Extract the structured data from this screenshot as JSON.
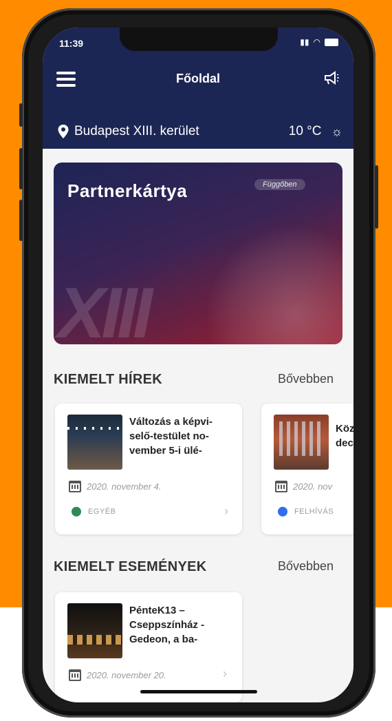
{
  "status": {
    "time": "11:39"
  },
  "header": {
    "title": "Főoldal",
    "location": "Budapest XIII. kerület",
    "temperature": "10 °C"
  },
  "card": {
    "title": "Partnerkártya",
    "badge": "Függőben",
    "watermark": "XIII"
  },
  "news": {
    "section_title": "KIEMELT HÍREK",
    "more_label": "Bővebben",
    "items": [
      {
        "title_lines": [
          "Változás a képvi-",
          "selő-testület no-",
          "vember 5-i ülé-"
        ],
        "date": "2020. november 4.",
        "category": "EGYÉB",
        "category_color": "#2e8b57"
      },
      {
        "title_lines": [
          "Köz",
          "dec"
        ],
        "date": "2020. nov",
        "category": "FELHÍVÁS",
        "category_color": "#2f6fe8"
      }
    ]
  },
  "events": {
    "section_title": "KIEMELT ESEMÉNYEK",
    "more_label": "Bővebben",
    "items": [
      {
        "title_lines": [
          "PénteK13 –",
          "Cseppszínház -",
          "Gedeon, a ba-"
        ],
        "date": "2020. november 20."
      }
    ]
  },
  "colors": {
    "orange": "#ff8c00",
    "header": "#1c2654"
  },
  "icons": {
    "menu": "hamburger-icon",
    "announce": "megaphone-icon",
    "location": "map-pin-icon",
    "weather": "sun-icon",
    "date": "calendar-icon"
  }
}
